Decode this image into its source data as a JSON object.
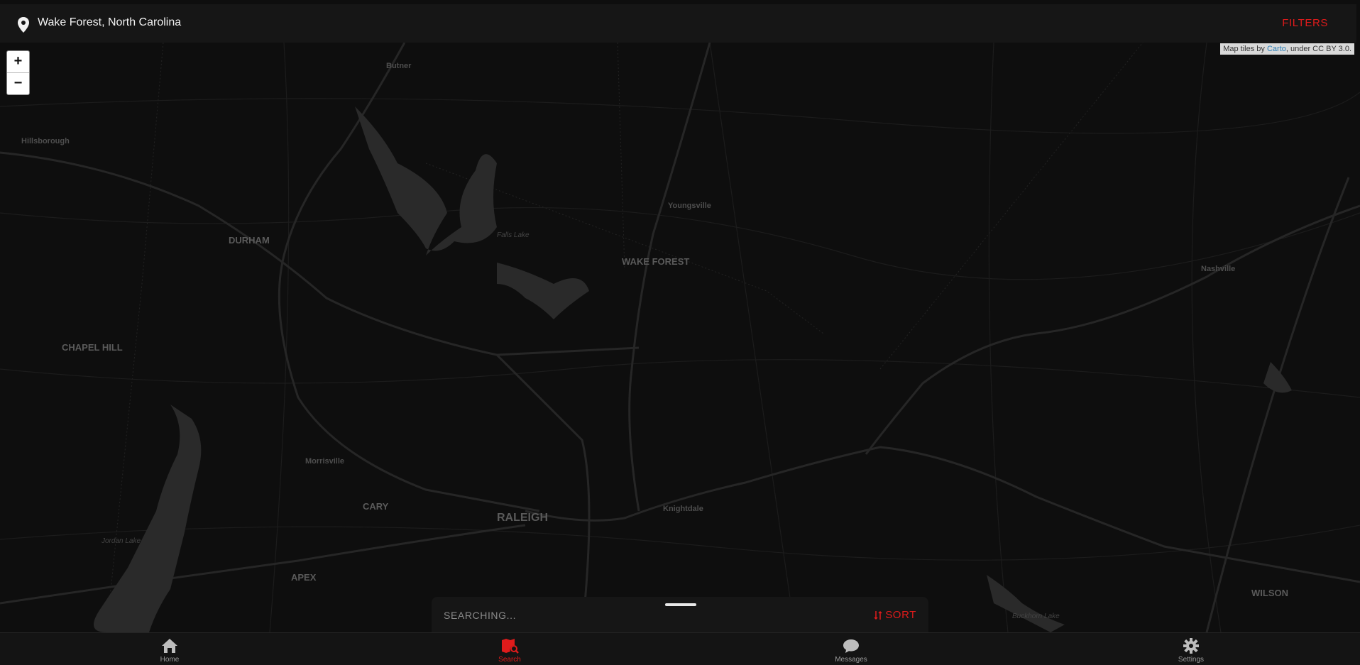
{
  "location": {
    "label": "Wake Forest, North Carolina"
  },
  "filters_label": "FILTERS",
  "zoom": {
    "in_label": "+",
    "out_label": "−"
  },
  "attribution": {
    "prefix": "Map tiles by ",
    "link": "Carto",
    "suffix": ", under CC BY 3.0."
  },
  "map": {
    "places": {
      "butner": "Butner",
      "hillsborough": "Hillsborough",
      "durham": "DURHAM",
      "youngsville": "Youngsville",
      "falls_lake": "Falls Lake",
      "wake_forest": "WAKE FOREST",
      "nashville": "Nashville",
      "chapel_hill": "CHAPEL HILL",
      "morrisville": "Morrisville",
      "cary": "CARY",
      "raleigh": "RALEIGH",
      "knightdale": "Knightdale",
      "apex": "APEX",
      "jordan_lake": "Jordan Lake",
      "wilson": "WILSON",
      "buckhorn_lake": "Buckhorn Lake"
    }
  },
  "results_sheet": {
    "status": "SEARCHING...",
    "sort_label": "SORT"
  },
  "nav": {
    "items": [
      {
        "label": "Home",
        "icon": "home-icon"
      },
      {
        "label": "Search",
        "icon": "map-search-icon",
        "active": true
      },
      {
        "label": "Messages",
        "icon": "chat-icon"
      },
      {
        "label": "Settings",
        "icon": "gear-icon"
      }
    ]
  },
  "colors": {
    "accent": "#e01b1b",
    "background": "#0d0d0d",
    "bar": "#161616"
  }
}
